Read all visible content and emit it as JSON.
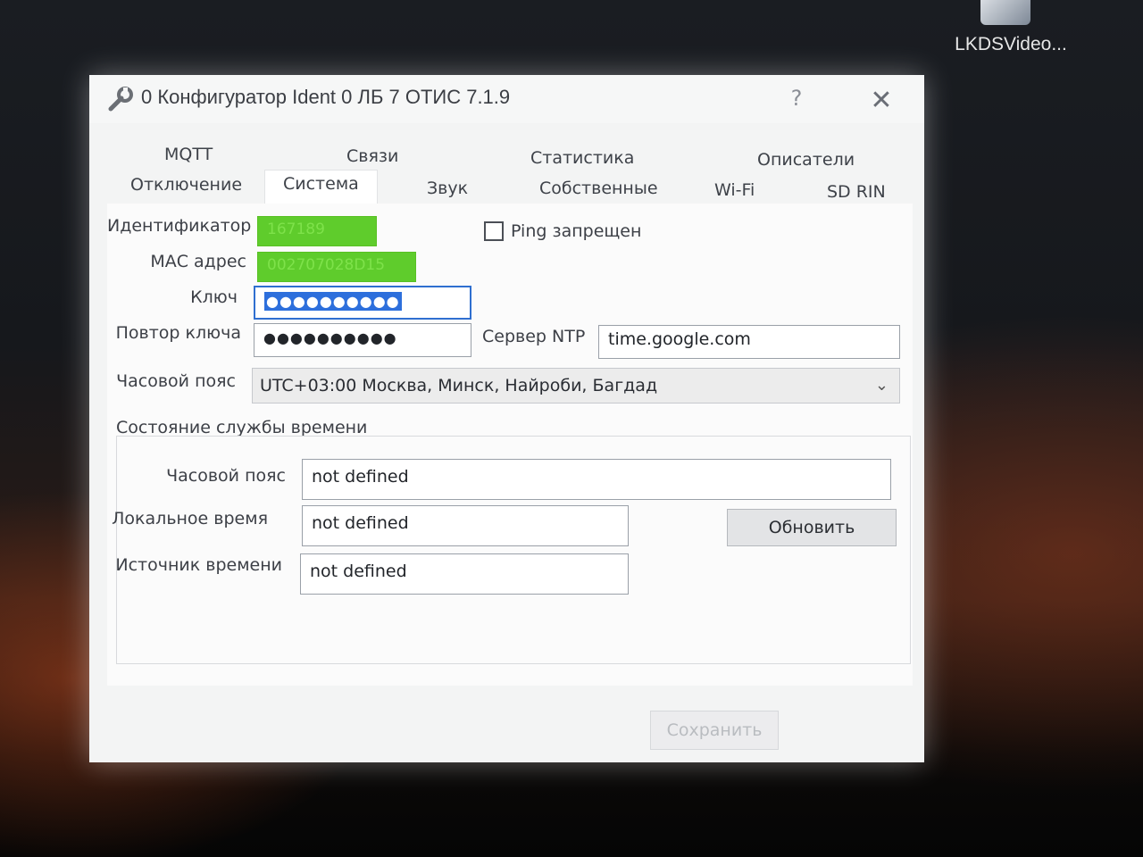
{
  "desktop": {
    "icon_label": "LKDSVideo..."
  },
  "window": {
    "title": "0 Конфигуратор Ident 0 ЛБ 7 ОТИС 7.1.9",
    "help_label": "?",
    "close_label": "✕"
  },
  "tabs": {
    "row1": [
      "MQTT",
      "Связи",
      "Статистика",
      "Описатели"
    ],
    "row2": [
      "Отключение",
      "Система",
      "Звук",
      "Собственные",
      "Wi-Fi",
      "SD RIN"
    ],
    "active": "Система"
  },
  "form": {
    "id_label": "Идентификатор",
    "id_value": "167189",
    "mac_label": "МАС адрес",
    "mac_value": "002707028D15",
    "key_label": "Ключ",
    "key_value": "●●●●●●●●●●",
    "key_repeat_label": "Повтор ключа",
    "key_repeat_value": "●●●●●●●●●●",
    "ping_label": "Ping запрещен",
    "ping_checked": false,
    "ntp_label": "Сервер NTP",
    "ntp_value": "time.google.com",
    "tz_label": "Часовой пояс",
    "tz_value": "UTC+03:00 Москва, Минск, Найроби, Багдад"
  },
  "time_service": {
    "group_label": "Состояние службы времени",
    "tz_label": "Часовой пояс",
    "tz_value": "not defined",
    "local_label": "Локальное время",
    "local_value": "not defined",
    "source_label": "Источник времени",
    "source_value": "not defined",
    "refresh_label": "Обновить"
  },
  "footer": {
    "save_label": "Сохранить"
  }
}
